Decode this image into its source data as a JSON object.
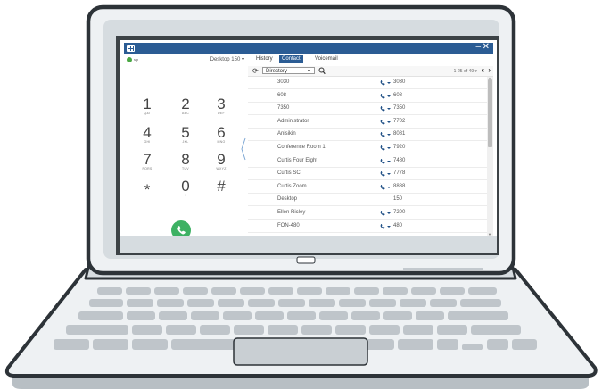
{
  "window": {
    "minimize": "–",
    "close": "✕"
  },
  "dialpad": {
    "status_text": "sip",
    "line_select": "Desktop 150 ▾",
    "keys": [
      {
        "digit": "1",
        "letters": "Q&I"
      },
      {
        "digit": "2",
        "letters": "ABC"
      },
      {
        "digit": "3",
        "letters": "DEF"
      },
      {
        "digit": "4",
        "letters": "GHI"
      },
      {
        "digit": "5",
        "letters": "JKL"
      },
      {
        "digit": "6",
        "letters": "MNO"
      },
      {
        "digit": "7",
        "letters": "PQRS"
      },
      {
        "digit": "8",
        "letters": "TUV"
      },
      {
        "digit": "9",
        "letters": "WXYZ"
      },
      {
        "digit": "*",
        "letters": ""
      },
      {
        "digit": "0",
        "letters": "+"
      },
      {
        "digit": "#",
        "letters": ""
      }
    ]
  },
  "tabs": {
    "history": "History",
    "contact": "Contact",
    "voicemail": "Voicemail"
  },
  "toolbar": {
    "directory": "Directory",
    "pager": "1-25 of 49 ▾"
  },
  "contacts": [
    {
      "name": "3030",
      "ext": "3030",
      "phone": true
    },
    {
      "name": "608",
      "ext": "608",
      "phone": true
    },
    {
      "name": "7350",
      "ext": "7350",
      "phone": true
    },
    {
      "name": "Administrator",
      "ext": "7702",
      "phone": true
    },
    {
      "name": "Anisikin",
      "ext": "8081",
      "phone": true
    },
    {
      "name": "Conference Room 1",
      "ext": "7920",
      "phone": true
    },
    {
      "name": "Curtis Four Eight",
      "ext": "7480",
      "phone": true
    },
    {
      "name": "Curtis SC",
      "ext": "7778",
      "phone": true
    },
    {
      "name": "Curtis Zoom",
      "ext": "8888",
      "phone": true
    },
    {
      "name": "Desktop",
      "ext": "150",
      "phone": false
    },
    {
      "name": "Ellen Ricley",
      "ext": "7200",
      "phone": true
    },
    {
      "name": "FON-480",
      "ext": "480",
      "phone": true
    }
  ]
}
